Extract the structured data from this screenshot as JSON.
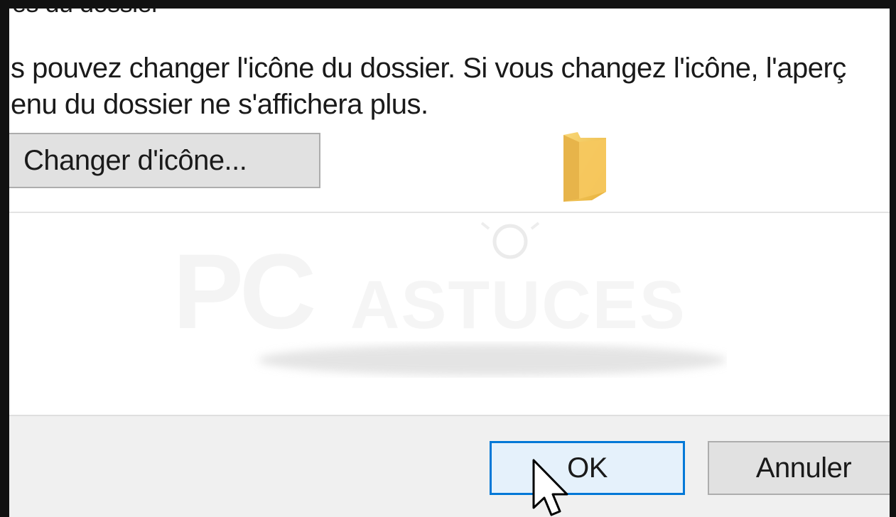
{
  "dialog": {
    "section_title": "es du dossier",
    "description_line1": "s pouvez changer l'icône du dossier. Si vous changez l'icône, l'aperç",
    "description_line2": "enu du dossier ne s'affichera plus.",
    "change_icon_label": "Changer d'icône...",
    "ok_label": "OK",
    "cancel_label": "Annuler"
  },
  "watermark": {
    "brand_pc": "PC",
    "brand_astuces": "ASTUCES"
  },
  "icons": {
    "folder": "folder-icon",
    "cursor": "mouse-pointer-icon"
  },
  "colors": {
    "accent": "#0078d7",
    "folder": "#f4c35a",
    "button_bg": "#e1e1e1",
    "footer_bg": "#f0f0f0"
  }
}
